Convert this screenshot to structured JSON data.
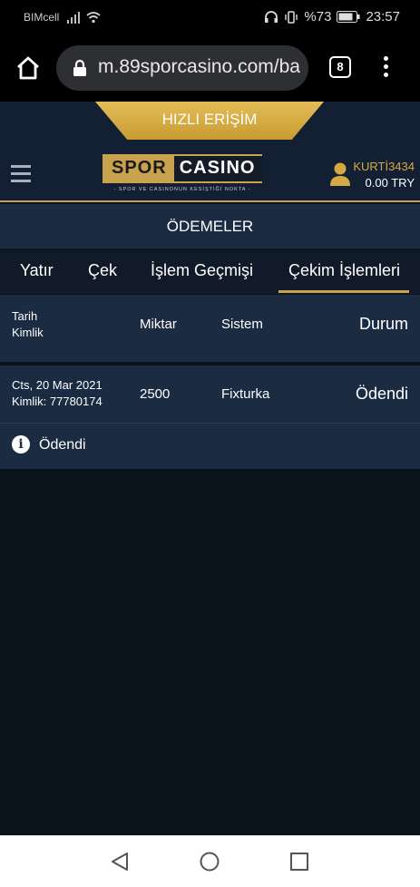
{
  "status_bar": {
    "carrier": "BIMcell",
    "battery": "%73",
    "time": "23:57"
  },
  "browser": {
    "url": "m.89sporcasino.com/ba",
    "tab_count": "8"
  },
  "header": {
    "quick_access": "HIZLI ERİŞİM",
    "logo": {
      "word1": "SPOR",
      "word2": "CASINO",
      "tagline": "- SPOR VE CASINONUN KESİŞTİĞİ NOKTA -"
    },
    "user": {
      "name": "KURTİ3434",
      "balance": "0.00 TRY"
    }
  },
  "payments": {
    "title": "ÖDEMELER",
    "tabs": [
      "Yatır",
      "Çek",
      "İşlem Geçmişi",
      "Çekim İşlemleri"
    ],
    "active_tab": "Çekim İşlemleri",
    "columns": {
      "date": "Tarih",
      "id": "Kimlik",
      "amount": "Miktar",
      "system": "Sistem",
      "status": "Durum"
    },
    "rows": [
      {
        "date": "Cts, 20 Mar 2021",
        "id": "Kimlik: 77780174",
        "amount": "2500",
        "system": "Fixturka",
        "status": "Ödendi"
      }
    ],
    "note": "Ödendi"
  },
  "colors": {
    "accent_gold": "#c9a24d",
    "panel": "#1b2b42",
    "background": "#0b131d"
  }
}
